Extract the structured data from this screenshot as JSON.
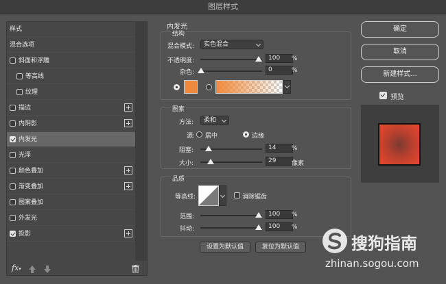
{
  "window": {
    "title": "图层样式"
  },
  "sidebar": {
    "items": [
      {
        "label": "样式",
        "checkbox": false,
        "plus": false,
        "indent": false,
        "checked": false,
        "selected": false
      },
      {
        "label": "混合选项",
        "checkbox": false,
        "plus": false,
        "indent": false,
        "checked": false,
        "selected": false
      },
      {
        "label": "斜面和浮雕",
        "checkbox": true,
        "plus": false,
        "indent": false,
        "checked": false,
        "selected": false
      },
      {
        "label": "等高线",
        "checkbox": true,
        "plus": false,
        "indent": true,
        "checked": false,
        "selected": false
      },
      {
        "label": "纹理",
        "checkbox": true,
        "plus": false,
        "indent": true,
        "checked": false,
        "selected": false
      },
      {
        "label": "描边",
        "checkbox": true,
        "plus": true,
        "indent": false,
        "checked": false,
        "selected": false
      },
      {
        "label": "内阴影",
        "checkbox": true,
        "plus": true,
        "indent": false,
        "checked": false,
        "selected": false
      },
      {
        "label": "内发光",
        "checkbox": true,
        "plus": false,
        "indent": false,
        "checked": true,
        "selected": true
      },
      {
        "label": "光泽",
        "checkbox": true,
        "plus": false,
        "indent": false,
        "checked": false,
        "selected": false
      },
      {
        "label": "颜色叠加",
        "checkbox": true,
        "plus": true,
        "indent": false,
        "checked": false,
        "selected": false
      },
      {
        "label": "渐变叠加",
        "checkbox": true,
        "plus": true,
        "indent": false,
        "checked": false,
        "selected": false
      },
      {
        "label": "图案叠加",
        "checkbox": true,
        "plus": false,
        "indent": false,
        "checked": false,
        "selected": false
      },
      {
        "label": "外发光",
        "checkbox": true,
        "plus": false,
        "indent": false,
        "checked": false,
        "selected": false
      },
      {
        "label": "投影",
        "checkbox": true,
        "plus": true,
        "indent": false,
        "checked": true,
        "selected": false
      }
    ],
    "footer": {
      "fx_label": "fx"
    }
  },
  "inner_glow": {
    "title": "内发光",
    "structure": {
      "title": "结构",
      "blend_mode_label": "混合模式:",
      "blend_mode_value": "实色混合",
      "opacity_label": "不透明度:",
      "opacity_value": "100",
      "noise_label": "杂色:",
      "noise_value": "0",
      "percent": "%",
      "glow_color": "#f08a3a"
    },
    "elements": {
      "title": "图素",
      "method_label": "方法:",
      "method_value": "柔和",
      "source_label": "源:",
      "source_center": "居中",
      "source_edge": "边缘",
      "source_selected": "边缘",
      "choke_label": "阻塞:",
      "choke_value": "14",
      "size_label": "大小:",
      "size_value": "29",
      "size_unit": "像素",
      "percent": "%"
    },
    "quality": {
      "title": "品质",
      "contour_label": "等高线:",
      "antialias_label": "消除锯齿",
      "range_label": "范围:",
      "range_value": "100",
      "jitter_label": "抖动:",
      "jitter_value": "100",
      "percent": "%"
    },
    "buttons": {
      "set_default": "设置为默认值",
      "reset_default": "复位为默认值"
    }
  },
  "actions": {
    "ok": "确定",
    "cancel": "取消",
    "new_style": "新建样式...",
    "preview_label": "预览",
    "preview_checked": true
  },
  "watermark": {
    "brand": "搜狗指南",
    "url": "zhinan.sogou.com"
  }
}
